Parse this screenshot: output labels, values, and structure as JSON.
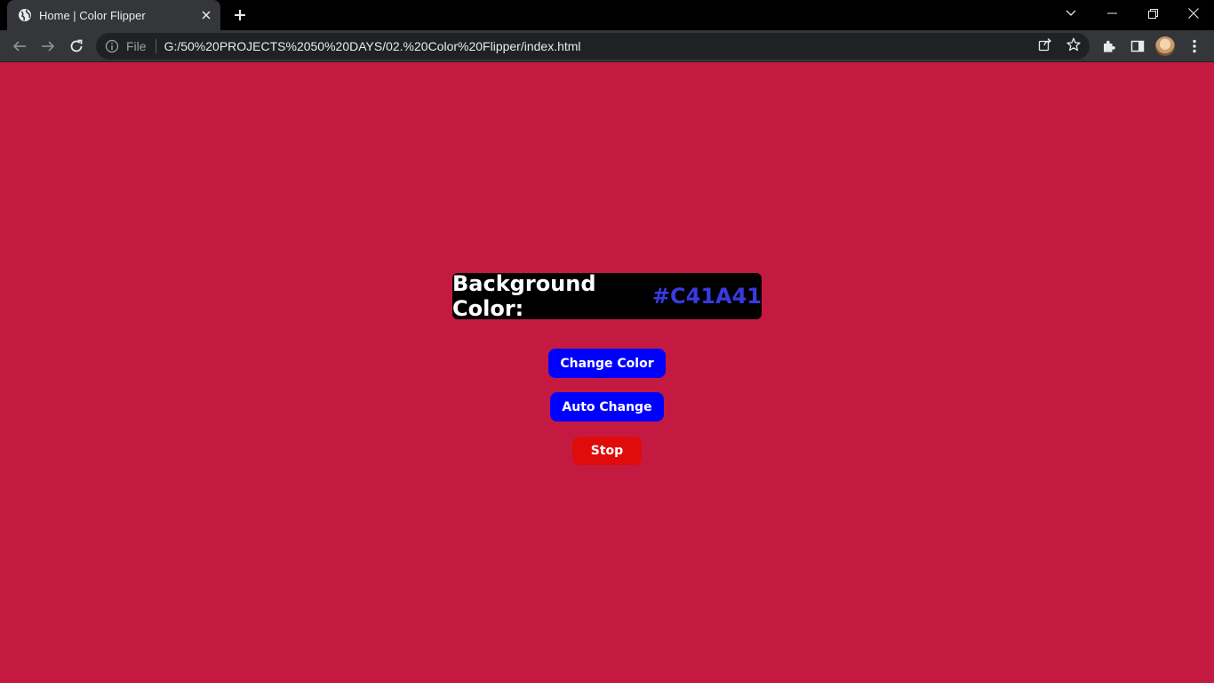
{
  "browser": {
    "tab_title": "Home | Color Flipper",
    "scheme": "File",
    "url": "G:/50%20PROJECTS%2050%20DAYS/02.%20Color%20Flipper/index.html"
  },
  "page": {
    "label_prefix": "Background Color:",
    "hex_value": "#C41A41",
    "buttons": {
      "change": "Change Color",
      "auto": "Auto Change",
      "stop": "Stop"
    }
  },
  "colors": {
    "page_background": "#C41A41",
    "hex_text": "#3A3AE0",
    "primary_button": "#0000FF",
    "stop_button": "#E00B0B",
    "label_background": "#000000"
  }
}
